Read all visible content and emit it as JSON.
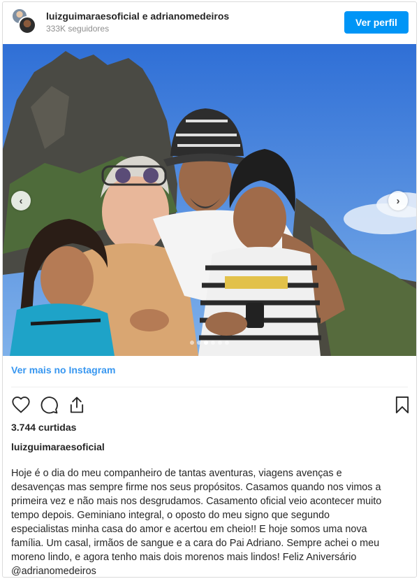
{
  "header": {
    "names": "luizguimaraesoficial e adrianomedeiros",
    "followers": "333K seguidores",
    "profile_button": "Ver perfil"
  },
  "photo": {
    "slide_count": 6,
    "active_slide": 3
  },
  "more_link": "Ver mais no Instagram",
  "likes": "3.744 curtidas",
  "owner": "luizguimaraesoficial",
  "caption_lines": [
    "Hoje é o dia do meu companheiro de tantas aventuras, viagens avenças e",
    "desavenças mas sempre firme nos seus propósitos. Casamos quando nos vimos a",
    "primeira vez e não mais nos desgrudamos. Casamento oficial veio acontecer muito",
    "tempo depois. Geminiano integral, o oposto do meu signo que segundo",
    "especialistas minha casa do amor e acertou em cheio!! E hoje somos uma nova",
    "família. Um casal, irmãos de sangue e a cara do Pai Adriano. Sempre achei o meu",
    "moreno lindo, e agora tenho mais dois morenos mais lindos! Feliz Aniversário"
  ],
  "caption_mention": "@adrianomedeiros",
  "colors": {
    "accent": "#0095f6",
    "link": "#3897f0",
    "sky": "#3b78d8"
  },
  "icons": [
    "heart-icon",
    "comment-icon",
    "share-icon",
    "bookmark-icon",
    "chevron-left-icon",
    "chevron-right-icon"
  ]
}
